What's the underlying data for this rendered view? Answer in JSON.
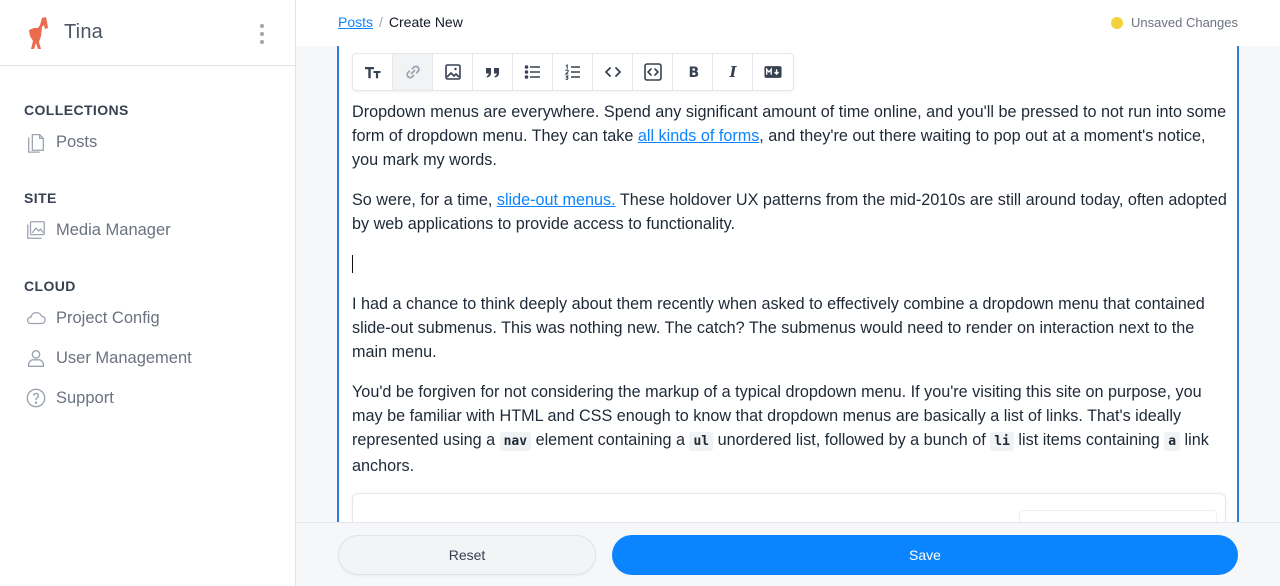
{
  "app": {
    "name": "Tina"
  },
  "sidebar": {
    "sections": [
      {
        "heading": "COLLECTIONS",
        "items": [
          {
            "label": "Posts",
            "icon": "document-icon"
          }
        ]
      },
      {
        "heading": "SITE",
        "items": [
          {
            "label": "Media Manager",
            "icon": "media-icon"
          }
        ]
      },
      {
        "heading": "CLOUD",
        "items": [
          {
            "label": "Project Config",
            "icon": "cloud-icon"
          },
          {
            "label": "User Management",
            "icon": "user-icon"
          },
          {
            "label": "Support",
            "icon": "help-circle-icon"
          }
        ]
      }
    ]
  },
  "breadcrumb": {
    "parent": "Posts",
    "separator": "/",
    "current": "Create New"
  },
  "status": {
    "label": "Unsaved Changes",
    "dot_color": "#f4d23b"
  },
  "toolbar": {
    "buttons": [
      "heading-icon",
      "link-icon",
      "image-icon",
      "quote-icon",
      "bulleted-list-icon",
      "numbered-list-icon",
      "code-inline-icon",
      "code-block-icon",
      "bold-icon",
      "italic-icon",
      "markdown-icon"
    ]
  },
  "content": {
    "p1": {
      "before": "Dropdown menus are everywhere. Spend any significant amount of time online, and you'll be pressed to not run into some form of dropdown menu. They can take ",
      "link": "all kinds of forms",
      "after": ", and they're out there waiting to pop out at a moment's notice, you mark my words."
    },
    "p2": {
      "before": "So were, for a time, ",
      "link": "slide-out menus.",
      "after": " These holdover UX patterns from the mid-2010s are still around today, often adopted by web applications to provide access to functionality."
    },
    "p3": "I had a chance to think deeply about them recently when asked to effectively combine a dropdown menu that contained slide-out submenus. This was nothing new. The catch? The submenus would need to render on interaction next to the main menu.",
    "p4": {
      "t1": "You'd be forgiven for not considering the markup of a typical dropdown menu. If you're visiting this site on purpose, you may be familiar with HTML and CSS enough to know that dropdown menus are basically a list of links. That's ideally represented using a ",
      "c1": "nav",
      "t2": " element containing a ",
      "c2": "ul",
      "t3": " unordered list, followed by a bunch of ",
      "c3": "li",
      "t4": " list items containing ",
      "c4": "a",
      "t5": " link anchors."
    }
  },
  "footer": {
    "reset_label": "Reset",
    "save_label": "Save"
  },
  "colors": {
    "accent": "#0b84ff",
    "editor_border": "#2b7fe3",
    "logo": "#ec6b4d"
  }
}
